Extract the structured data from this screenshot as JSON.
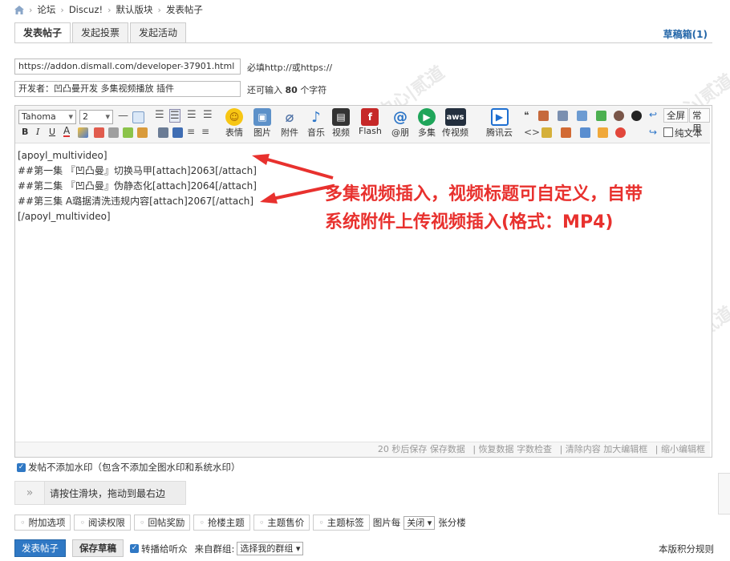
{
  "breadcrumb": [
    "论坛",
    "Discuz!",
    "默认版块",
    "发表帖子"
  ],
  "tabs": [
    "发表帖子",
    "发起投票",
    "发起活动"
  ],
  "draftbox": "草稿箱(1)",
  "url_input": {
    "value": "https://addon.dismall.com/developer-37901.html",
    "hint": "必填http://或https://"
  },
  "title_input": {
    "value": "开发者：凹凸曼开发 多集视频播放 插件",
    "hint_prefix": "还可输入",
    "hint_count": "80",
    "hint_suffix": "个字符"
  },
  "toolbar": {
    "font": "Tahoma",
    "size": "2",
    "fullscreen": "全屏",
    "common": "常用",
    "plaintext": "纯文本",
    "buttons": [
      "表情",
      "图片",
      "附件",
      "音乐",
      "视频",
      "Flash",
      "@朋",
      "多集",
      "传视频",
      "腾讯云"
    ],
    "aws_label": "aws"
  },
  "content_lines": [
    "[apoyl_multivideo]",
    "##第一集 『凹凸曼』切换马甲[attach]2063[/attach]",
    "##第二集 『凹凸曼』伪静态化[attach]2064[/attach]",
    "##第三集 A璐据清洗违规内容[attach]2067[/attach]",
    "[/apoyl_multivideo]"
  ],
  "annotation": [
    "多集视频插入，视频标题可自定义，自带",
    "系统附件上传视频插入(格式：MP4)"
  ],
  "statusbar": [
    "20 秒后保存",
    "保存数据",
    "|",
    "恢复数据",
    "字数检查",
    "|",
    "清除内容",
    "加大编辑框",
    "|",
    "缩小编辑框"
  ],
  "watermark_checkbox": "发帖不添加水印（包含不添加全图水印和系统水印）",
  "slider": {
    "arrows": "»",
    "label": "请按住滑块，拖动到最右边"
  },
  "options": [
    "附加选项",
    "阅读权限",
    "回帖奖励",
    "抢楼主题",
    "主题售价",
    "主题标签"
  ],
  "per_floor": {
    "prefix": "图片每",
    "value": "关闭",
    "suffix": "张分楼"
  },
  "submit": "发表帖子",
  "save_draft": "保存草稿",
  "forward": "转播给听众",
  "group_label": "来自群组:",
  "group_select": "选择我的群组",
  "rules_link": "本版积分规则",
  "colors": {
    "accent": "#2f78c4",
    "annotation": "#e8312e"
  }
}
